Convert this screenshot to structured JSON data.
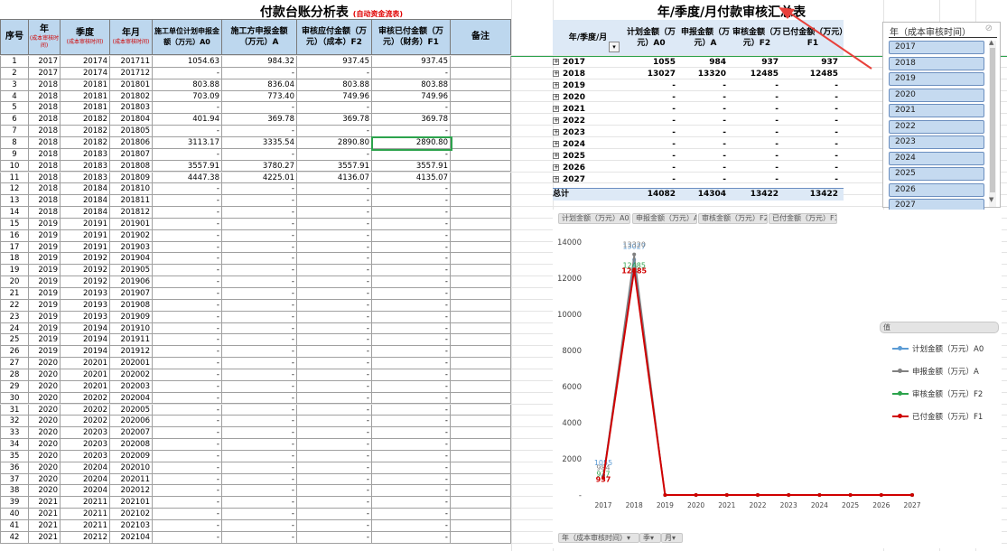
{
  "ledger": {
    "title": "付款台账分析表",
    "subtitle": "(自动资金流表)",
    "headers": {
      "seq": "序号",
      "year": "年",
      "year_sub": "(成本审核时间)",
      "quarter": "季度",
      "quarter_sub": "(成本审核时间)",
      "month": "年月",
      "month_sub": "(成本审核时间)",
      "a0": "施工单位计划申报金额（万元）A0",
      "a": "施工方申报金额（万元）A",
      "f2": "审核应付金额（万元）（成本）F2",
      "f1": "审核已付金额（万元）（财务）F1",
      "note": "备注"
    },
    "rows": [
      [
        "1",
        "2017",
        "20174",
        "201711",
        "1054.63",
        "984.32",
        "937.45",
        "937.45"
      ],
      [
        "2",
        "2017",
        "20174",
        "201712",
        "-",
        "-",
        "-",
        "-"
      ],
      [
        "3",
        "2018",
        "20181",
        "201801",
        "803.88",
        "836.04",
        "803.88",
        "803.88"
      ],
      [
        "4",
        "2018",
        "20181",
        "201802",
        "703.09",
        "773.40",
        "749.96",
        "749.96"
      ],
      [
        "5",
        "2018",
        "20181",
        "201803",
        "-",
        "-",
        "-",
        "-"
      ],
      [
        "6",
        "2018",
        "20182",
        "201804",
        "401.94",
        "369.78",
        "369.78",
        "369.78"
      ],
      [
        "7",
        "2018",
        "20182",
        "201805",
        "-",
        "-",
        "-",
        "-"
      ],
      [
        "8",
        "2018",
        "20182",
        "201806",
        "3113.17",
        "3335.54",
        "2890.80",
        "2890.80"
      ],
      [
        "9",
        "2018",
        "20183",
        "201807",
        "-",
        "-",
        "-",
        "-"
      ],
      [
        "10",
        "2018",
        "20183",
        "201808",
        "3557.91",
        "3780.27",
        "3557.91",
        "3557.91"
      ],
      [
        "11",
        "2018",
        "20183",
        "201809",
        "4447.38",
        "4225.01",
        "4136.07",
        "4135.07"
      ],
      [
        "12",
        "2018",
        "20184",
        "201810",
        "-",
        "-",
        "-",
        "-"
      ],
      [
        "13",
        "2018",
        "20184",
        "201811",
        "-",
        "-",
        "-",
        "-"
      ],
      [
        "14",
        "2018",
        "20184",
        "201812",
        "-",
        "-",
        "-",
        "-"
      ],
      [
        "15",
        "2019",
        "20191",
        "201901",
        "-",
        "-",
        "-",
        "-"
      ],
      [
        "16",
        "2019",
        "20191",
        "201902",
        "-",
        "-",
        "-",
        "-"
      ],
      [
        "17",
        "2019",
        "20191",
        "201903",
        "-",
        "-",
        "-",
        "-"
      ],
      [
        "18",
        "2019",
        "20192",
        "201904",
        "-",
        "-",
        "-",
        "-"
      ],
      [
        "19",
        "2019",
        "20192",
        "201905",
        "-",
        "-",
        "-",
        "-"
      ],
      [
        "20",
        "2019",
        "20192",
        "201906",
        "-",
        "-",
        "-",
        "-"
      ],
      [
        "21",
        "2019",
        "20193",
        "201907",
        "-",
        "-",
        "-",
        "-"
      ],
      [
        "22",
        "2019",
        "20193",
        "201908",
        "-",
        "-",
        "-",
        "-"
      ],
      [
        "23",
        "2019",
        "20193",
        "201909",
        "-",
        "-",
        "-",
        "-"
      ],
      [
        "24",
        "2019",
        "20194",
        "201910",
        "-",
        "-",
        "-",
        "-"
      ],
      [
        "25",
        "2019",
        "20194",
        "201911",
        "-",
        "-",
        "-",
        "-"
      ],
      [
        "26",
        "2019",
        "20194",
        "201912",
        "-",
        "-",
        "-",
        "-"
      ],
      [
        "27",
        "2020",
        "20201",
        "202001",
        "-",
        "-",
        "-",
        "-"
      ],
      [
        "28",
        "2020",
        "20201",
        "202002",
        "-",
        "-",
        "-",
        "-"
      ],
      [
        "29",
        "2020",
        "20201",
        "202003",
        "-",
        "-",
        "-",
        "-"
      ],
      [
        "30",
        "2020",
        "20202",
        "202004",
        "-",
        "-",
        "-",
        "-"
      ],
      [
        "31",
        "2020",
        "20202",
        "202005",
        "-",
        "-",
        "-",
        "-"
      ],
      [
        "32",
        "2020",
        "20202",
        "202006",
        "-",
        "-",
        "-",
        "-"
      ],
      [
        "33",
        "2020",
        "20203",
        "202007",
        "-",
        "-",
        "-",
        "-"
      ],
      [
        "34",
        "2020",
        "20203",
        "202008",
        "-",
        "-",
        "-",
        "-"
      ],
      [
        "35",
        "2020",
        "20203",
        "202009",
        "-",
        "-",
        "-",
        "-"
      ],
      [
        "36",
        "2020",
        "20204",
        "202010",
        "-",
        "-",
        "-",
        "-"
      ],
      [
        "37",
        "2020",
        "20204",
        "202011",
        "-",
        "-",
        "-",
        "-"
      ],
      [
        "38",
        "2020",
        "20204",
        "202012",
        "-",
        "-",
        "-",
        "-"
      ],
      [
        "39",
        "2021",
        "20211",
        "202101",
        "-",
        "-",
        "-",
        "-"
      ],
      [
        "40",
        "2021",
        "20211",
        "202102",
        "-",
        "-",
        "-",
        "-"
      ],
      [
        "41",
        "2021",
        "20211",
        "202103",
        "-",
        "-",
        "-",
        "-"
      ],
      [
        "42",
        "2021",
        "20212",
        "202104",
        "-",
        "-",
        "-",
        "-"
      ]
    ]
  },
  "pivot": {
    "title": "年/季度/月付款审核汇总表",
    "headers": [
      "年/季度/月",
      "计划金额（万元）A0",
      "申报金额（万元）A",
      "审核金额（万元）F2",
      "已付金额（万元）F1"
    ],
    "dropdown_glyph": "▾",
    "expand_glyph": "+",
    "rows": [
      [
        "2017",
        "1055",
        "984",
        "937",
        "937"
      ],
      [
        "2018",
        "13027",
        "13320",
        "12485",
        "12485"
      ],
      [
        "2019",
        "-",
        "-",
        "-",
        "-"
      ],
      [
        "2020",
        "-",
        "-",
        "-",
        "-"
      ],
      [
        "2021",
        "-",
        "-",
        "-",
        "-"
      ],
      [
        "2022",
        "-",
        "-",
        "-",
        "-"
      ],
      [
        "2023",
        "-",
        "-",
        "-",
        "-"
      ],
      [
        "2024",
        "-",
        "-",
        "-",
        "-"
      ],
      [
        "2025",
        "-",
        "-",
        "-",
        "-"
      ],
      [
        "2026",
        "-",
        "-",
        "-",
        "-"
      ],
      [
        "2027",
        "-",
        "-",
        "-",
        "-"
      ]
    ],
    "total": [
      "总计",
      "14082",
      "14304",
      "13422",
      "13422"
    ]
  },
  "slicer": {
    "title": "年（成本审核时间）",
    "clear_icon": "filter-clear-icon",
    "clear_glyph": "⊘",
    "items": [
      "2017",
      "2018",
      "2019",
      "2020",
      "2021",
      "2022",
      "2023",
      "2024",
      "2025",
      "2026",
      "2027"
    ],
    "scroll_up": "▲",
    "scroll_down": "▼"
  },
  "chart_buttons": {
    "series_fields": [
      "计划金额（万元）A0",
      "申报金额（万元）A",
      "审核金额（万元）F2",
      "已付金额（万元）F1"
    ],
    "values_field": "值",
    "axis_fields": [
      "年（成本审核时间）▾",
      "季▾",
      "月▾"
    ]
  },
  "chart_data": {
    "type": "line",
    "x": [
      "2017",
      "2018",
      "2019",
      "2020",
      "2021",
      "2022",
      "2023",
      "2024",
      "2025",
      "2026",
      "2027"
    ],
    "ylim": [
      0,
      14000
    ],
    "yticks": [
      "-",
      "2000",
      "4000",
      "6000",
      "8000",
      "10000",
      "12000",
      "14000"
    ],
    "legend_position": "right",
    "series": [
      {
        "name": "计划金额（万元）A0",
        "color": "#5b9bd5",
        "values": [
          1055,
          13027,
          0,
          0,
          0,
          0,
          0,
          0,
          0,
          0,
          0
        ],
        "labels": [
          "1055",
          "13027"
        ]
      },
      {
        "name": "申报金额（万元）A",
        "color": "#808080",
        "values": [
          984,
          13320,
          0,
          0,
          0,
          0,
          0,
          0,
          0,
          0,
          0
        ],
        "labels": [
          "984",
          "13320"
        ]
      },
      {
        "name": "审核金额（万元）F2",
        "color": "#2ca34c",
        "values": [
          937,
          12485,
          0,
          0,
          0,
          0,
          0,
          0,
          0,
          0,
          0
        ],
        "labels": [
          "937",
          "12485"
        ]
      },
      {
        "name": "已付金额（万元）F1",
        "color": "#d00000",
        "values": [
          937,
          12485,
          0,
          0,
          0,
          0,
          0,
          0,
          0,
          0,
          0
        ],
        "labels": [
          "937",
          "12485"
        ]
      }
    ]
  }
}
